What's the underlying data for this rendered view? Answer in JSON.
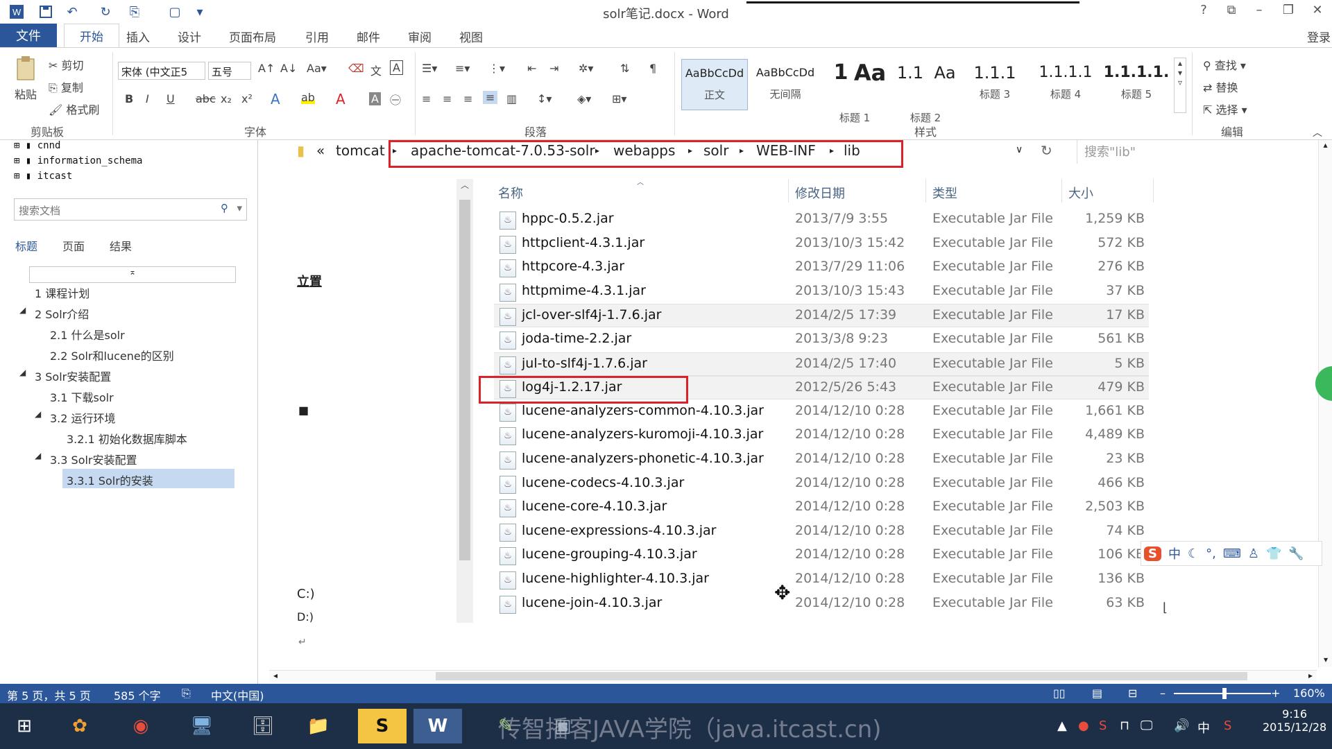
{
  "window": {
    "title": "solr笔记.docx - Word",
    "help": "?",
    "login": "登录"
  },
  "tabs": [
    "文件",
    "开始",
    "插入",
    "设计",
    "页面布局",
    "引用",
    "邮件",
    "审阅",
    "视图"
  ],
  "ribbon": {
    "clipboard": {
      "paste": "粘贴",
      "cut": "剪切",
      "copy": "复制",
      "format_painter": "格式刷",
      "label": "剪贴板"
    },
    "font": {
      "name": "宋体 (中文正5",
      "size": "五号",
      "label": "字体"
    },
    "paragraph": {
      "label": "段落"
    },
    "styles": {
      "label": "样式",
      "items": [
        {
          "sample": "AaBbCcDd",
          "name": "正文"
        },
        {
          "sample": "AaBbCcDd",
          "name": "无间隔"
        },
        {
          "sample": "1",
          "name": "标题 1"
        },
        {
          "sample": "1.1",
          "name": "标题 2"
        },
        {
          "sample": "1.1.1",
          "name": "标题 3"
        },
        {
          "sample": "1.1.1.1",
          "name": "标题 4"
        },
        {
          "sample": "1.1.1.1.",
          "name": "标题 5"
        }
      ],
      "extra_samples": [
        "Aa",
        "Aa"
      ]
    },
    "editing": {
      "find": "查找",
      "replace": "替换",
      "select": "选择",
      "label": "编辑"
    }
  },
  "nav": {
    "db_items": [
      "cnnd",
      "information_schema",
      "itcast"
    ],
    "search_placeholder": "搜索文档",
    "tabs": [
      "标题",
      "页面",
      "结果"
    ],
    "headings": [
      {
        "text": "1 课程计划",
        "level": 1
      },
      {
        "text": "2 Solr介绍",
        "level": 1
      },
      {
        "text": "2.1 什么是solr",
        "level": 2
      },
      {
        "text": "2.2 Solr和lucene的区别",
        "level": 2
      },
      {
        "text": "3 Solr安装配置",
        "level": 1
      },
      {
        "text": "3.1 下载solr",
        "level": 2
      },
      {
        "text": "3.2 运行环境",
        "level": 2
      },
      {
        "text": "3.2.1 初始化数据库脚本",
        "level": 3
      },
      {
        "text": "3.3 Solr安装配置",
        "level": 2
      },
      {
        "text": "3.3.1 Solr的安装",
        "level": 3
      }
    ]
  },
  "doc_fragments": {
    "loc_label": "立置",
    "drive_c": "C:)",
    "drive_d": "D:)"
  },
  "explorer": {
    "crumbs": [
      "tomcat",
      "apache-tomcat-7.0.53-solr",
      "webapps",
      "solr",
      "WEB-INF",
      "lib"
    ],
    "search_placeholder": "搜索\"lib\"",
    "columns": {
      "name": "名称",
      "date": "修改日期",
      "type": "类型",
      "size": "大小"
    },
    "files": [
      {
        "name": "hppc-0.5.2.jar",
        "date": "2013/7/9 3:55",
        "type": "Executable Jar File",
        "size": "1,259 KB"
      },
      {
        "name": "httpclient-4.3.1.jar",
        "date": "2013/10/3 15:42",
        "type": "Executable Jar File",
        "size": "572 KB"
      },
      {
        "name": "httpcore-4.3.jar",
        "date": "2013/7/29 11:06",
        "type": "Executable Jar File",
        "size": "276 KB"
      },
      {
        "name": "httpmime-4.3.1.jar",
        "date": "2013/10/3 15:43",
        "type": "Executable Jar File",
        "size": "37 KB"
      },
      {
        "name": "jcl-over-slf4j-1.7.6.jar",
        "date": "2014/2/5 17:39",
        "type": "Executable Jar File",
        "size": "17 KB"
      },
      {
        "name": "joda-time-2.2.jar",
        "date": "2013/3/8 9:23",
        "type": "Executable Jar File",
        "size": "561 KB"
      },
      {
        "name": "jul-to-slf4j-1.7.6.jar",
        "date": "2014/2/5 17:40",
        "type": "Executable Jar File",
        "size": "5 KB"
      },
      {
        "name": "log4j-1.2.17.jar",
        "date": "2012/5/26 5:43",
        "type": "Executable Jar File",
        "size": "479 KB"
      },
      {
        "name": "lucene-analyzers-common-4.10.3.jar",
        "date": "2014/12/10 0:28",
        "type": "Executable Jar File",
        "size": "1,661 KB"
      },
      {
        "name": "lucene-analyzers-kuromoji-4.10.3.jar",
        "date": "2014/12/10 0:28",
        "type": "Executable Jar File",
        "size": "4,489 KB"
      },
      {
        "name": "lucene-analyzers-phonetic-4.10.3.jar",
        "date": "2014/12/10 0:28",
        "type": "Executable Jar File",
        "size": "23 KB"
      },
      {
        "name": "lucene-codecs-4.10.3.jar",
        "date": "2014/12/10 0:28",
        "type": "Executable Jar File",
        "size": "466 KB"
      },
      {
        "name": "lucene-core-4.10.3.jar",
        "date": "2014/12/10 0:28",
        "type": "Executable Jar File",
        "size": "2,503 KB"
      },
      {
        "name": "lucene-expressions-4.10.3.jar",
        "date": "2014/12/10 0:28",
        "type": "Executable Jar File",
        "size": "74 KB"
      },
      {
        "name": "lucene-grouping-4.10.3.jar",
        "date": "2014/12/10 0:28",
        "type": "Executable Jar File",
        "size": "106 KB"
      },
      {
        "name": "lucene-highlighter-4.10.3.jar",
        "date": "2014/12/10 0:28",
        "type": "Executable Jar File",
        "size": "136 KB"
      },
      {
        "name": "lucene-join-4.10.3.jar",
        "date": "2014/12/10 0:28",
        "type": "Executable Jar File",
        "size": "63 KB"
      }
    ]
  },
  "status": {
    "page": "第 5 页，共 5 页",
    "words": "585 个字",
    "lang": "中文(中国)",
    "zoom": "160%"
  },
  "taskbar": {
    "watermark": "传智播客JAVA学院（java.itcast.cn)",
    "ime": "中",
    "time": "9:16",
    "date": "2015/12/28"
  },
  "colors": {
    "accent": "#2b579a",
    "highlight_box": "#d9232b",
    "taskbar": "#1d2e47"
  }
}
